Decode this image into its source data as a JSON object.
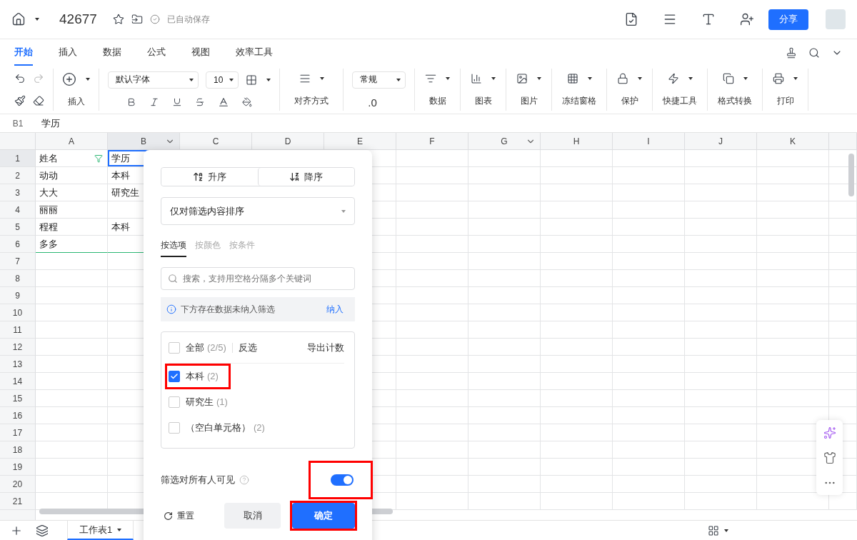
{
  "topbar": {
    "title": "42677",
    "save_status": "已自动保存",
    "share": "分享"
  },
  "ribbon_tabs": [
    {
      "label": "开始",
      "selected": true
    },
    {
      "label": "插入",
      "selected": false
    },
    {
      "label": "数据",
      "selected": false
    },
    {
      "label": "公式",
      "selected": false
    },
    {
      "label": "视图",
      "selected": false
    },
    {
      "label": "效率工具",
      "selected": false
    }
  ],
  "toolbar": {
    "insert": "插入",
    "font": "默认字体",
    "font_size": "10",
    "align": "对齐方式",
    "number_format": "常规",
    "decimal": ".0",
    "groups": [
      {
        "label": "数据",
        "kind": "data"
      },
      {
        "label": "图表",
        "kind": "chart"
      },
      {
        "label": "图片",
        "kind": "image"
      },
      {
        "label": "冻结窗格",
        "kind": "freeze"
      },
      {
        "label": "保护",
        "kind": "lock"
      },
      {
        "label": "快捷工具",
        "kind": "quick"
      },
      {
        "label": "格式转换",
        "kind": "convert"
      },
      {
        "label": "打印",
        "kind": "print"
      }
    ]
  },
  "formula_bar": {
    "cell": "B1",
    "value": "学历"
  },
  "columns": [
    {
      "label": "A",
      "filter": false,
      "selected": false
    },
    {
      "label": "B",
      "filter": true,
      "selected": true
    },
    {
      "label": "C",
      "filter": false,
      "selected": false
    },
    {
      "label": "D",
      "filter": false,
      "selected": false
    },
    {
      "label": "E",
      "filter": false,
      "selected": false
    },
    {
      "label": "F",
      "filter": false,
      "selected": false
    },
    {
      "label": "G",
      "filter": true,
      "selected": false
    },
    {
      "label": "H",
      "filter": false,
      "selected": false
    },
    {
      "label": "I",
      "filter": false,
      "selected": false
    },
    {
      "label": "J",
      "filter": false,
      "selected": false
    },
    {
      "label": "K",
      "filter": false,
      "selected": false
    }
  ],
  "rows": [
    {
      "number": "1",
      "cells": [
        "姓名",
        "学历"
      ]
    },
    {
      "number": "2",
      "cells": [
        "动动",
        "本科"
      ]
    },
    {
      "number": "3",
      "cells": [
        "大大",
        "研究生"
      ]
    },
    {
      "number": "4",
      "cells": [
        "丽丽",
        ""
      ]
    },
    {
      "number": "5",
      "cells": [
        "程程",
        "本科"
      ]
    },
    {
      "number": "6",
      "cells": [
        "多多",
        ""
      ]
    },
    {
      "number": "7",
      "cells": []
    },
    {
      "number": "8",
      "cells": []
    },
    {
      "number": "9",
      "cells": []
    },
    {
      "number": "10",
      "cells": []
    },
    {
      "number": "11",
      "cells": []
    },
    {
      "number": "12",
      "cells": []
    },
    {
      "number": "13",
      "cells": []
    },
    {
      "number": "14",
      "cells": []
    },
    {
      "number": "15",
      "cells": []
    },
    {
      "number": "16",
      "cells": []
    },
    {
      "number": "17",
      "cells": []
    },
    {
      "number": "18",
      "cells": []
    },
    {
      "number": "19",
      "cells": []
    },
    {
      "number": "20",
      "cells": []
    },
    {
      "number": "21",
      "cells": []
    }
  ],
  "filter_popup": {
    "sort_buttons": [
      "升序",
      "降序"
    ],
    "sort_scope": "仅对筛选内容排序",
    "tabs": [
      {
        "label": "按选项",
        "selected": true
      },
      {
        "label": "按颜色",
        "selected": false
      },
      {
        "label": "按条件",
        "selected": false
      }
    ],
    "search": {
      "placeholder": "搜索，支持用空格分隔多个关键词"
    },
    "notice": "下方存在数据未纳入筛选",
    "notice_action": "纳入",
    "select_all": {
      "label": "全部",
      "count": "(2/5)",
      "checked": false
    },
    "invert": "反选",
    "export": "导出计数",
    "options": [
      {
        "label": "本科",
        "count": "(2)",
        "checked": true,
        "highlighted": true
      },
      {
        "label": "研究生",
        "count": "(1)",
        "checked": false,
        "highlighted": false
      },
      {
        "label": "（空白单元格）",
        "count": "(2)",
        "checked": false,
        "highlighted": false
      }
    ],
    "visible_toggle": {
      "label": "筛选对所有人可见",
      "on": true,
      "highlighted": true
    },
    "reset": "重置",
    "cancel": "取消",
    "confirm": {
      "label": "确定",
      "highlighted": true
    }
  },
  "sheet_tabs": [
    {
      "label": "工作表1",
      "selected": true
    }
  ]
}
